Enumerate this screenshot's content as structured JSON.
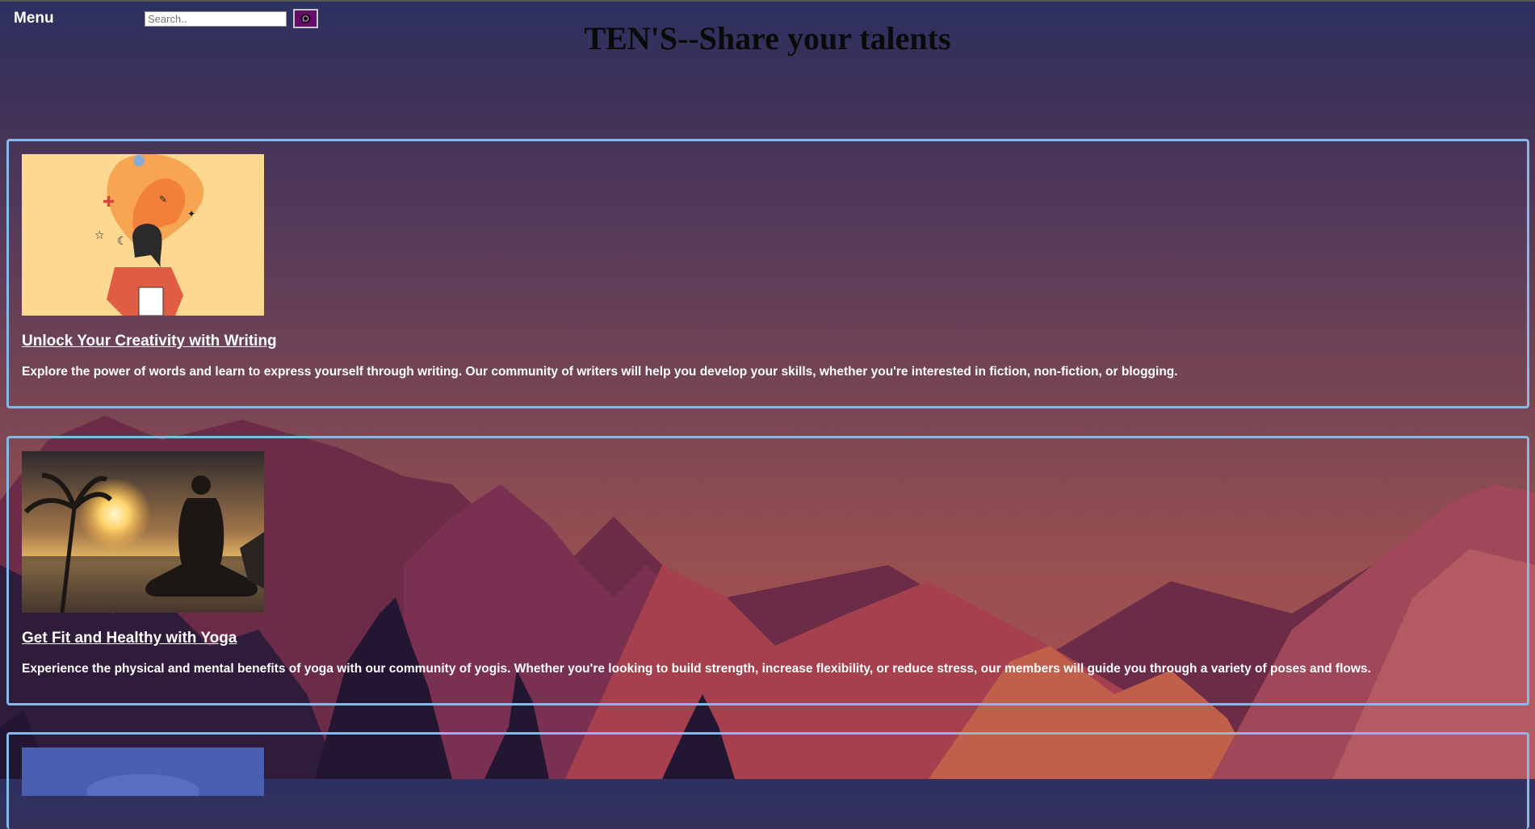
{
  "header": {
    "menu_label": "Menu",
    "search_placeholder": "Search..",
    "search_button_icon": "search-icon",
    "page_title": "TEN'S--Share your talents"
  },
  "cards": [
    {
      "image_icon": "writing-illustration",
      "title": "Unlock Your Creativity with Writing",
      "description": "Explore the power of words and learn to express yourself through writing. Our community of writers will help you develop your skills, whether you're interested in fiction, non-fiction, or blogging."
    },
    {
      "image_icon": "yoga-sunset-photo",
      "title": "Get Fit and Healthy with Yoga",
      "description": "Experience the physical and mental benefits of yoga with our community of yogis. Whether you're looking to build strength, increase flexibility, or reduce stress, our members will guide you through a variety of poses and flows."
    },
    {
      "image_icon": "blue-image-partial"
    }
  ],
  "colors": {
    "card_border": "#86b9e8",
    "search_button": "#6a0a6a",
    "title_text": "#0a0a0a",
    "sky_top": "#2c3160",
    "sky_bottom": "#a8524e"
  }
}
